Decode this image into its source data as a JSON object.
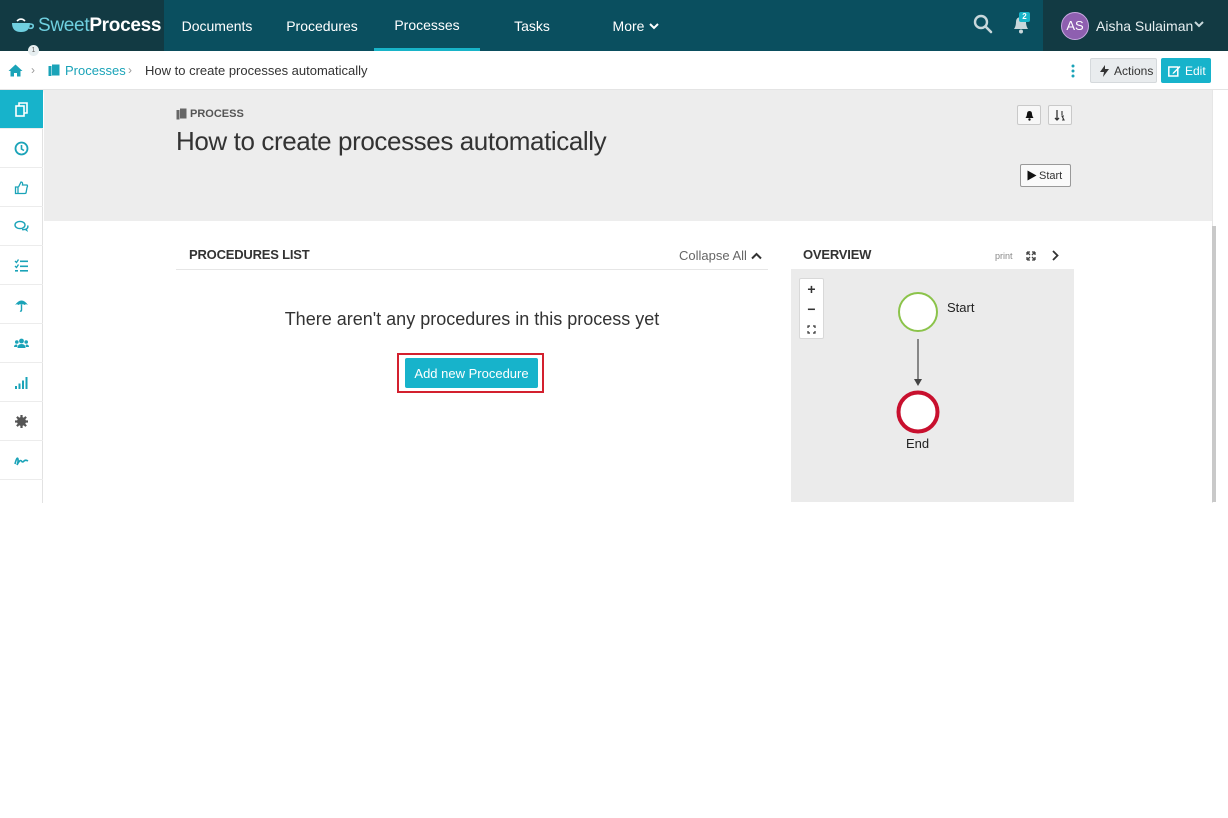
{
  "brand": {
    "light": "Sweet",
    "bold": "Process"
  },
  "nav": {
    "items": [
      {
        "label": "Documents"
      },
      {
        "label": "Procedures"
      },
      {
        "label": "Processes"
      },
      {
        "label": "Tasks"
      },
      {
        "label": "More"
      }
    ],
    "active_item": "Processes",
    "notifications_count": "2"
  },
  "user": {
    "initials": "AS",
    "name": "Aisha Sulaiman"
  },
  "breadcrumb": {
    "section": "Processes",
    "current": "How to create processes automatically"
  },
  "toolbar": {
    "actions_label": "Actions",
    "edit_label": "Edit"
  },
  "sidebar": {
    "items": [
      {
        "icon": "documents-icon"
      },
      {
        "icon": "clock-icon",
        "badge": "1"
      },
      {
        "icon": "thumbs-up-icon"
      },
      {
        "icon": "comments-icon"
      },
      {
        "icon": "checklist-icon"
      },
      {
        "icon": "umbrella-icon"
      },
      {
        "icon": "users-icon"
      },
      {
        "icon": "signal-bars-icon"
      },
      {
        "icon": "gear-icon"
      },
      {
        "icon": "signature-icon"
      }
    ]
  },
  "header": {
    "type_label": "PROCESS",
    "title": "How to create processes automatically",
    "start_label": "Start"
  },
  "procedures": {
    "title": "PROCEDURES LIST",
    "collapse_label": "Collapse All",
    "empty_message": "There aren't any procedures in this process yet",
    "add_label": "Add new Procedure"
  },
  "overview": {
    "title": "OVERVIEW",
    "print_label": "print",
    "zoom_in": "+",
    "zoom_out": "−",
    "start_node": "Start",
    "end_node": "End"
  },
  "colors": {
    "topbar": "#0a4f5f",
    "brand_dark": "#123a43",
    "accent": "#17b3cb",
    "highlight": "#d3202e",
    "start_node": "#8bc34a",
    "end_node": "#c8102e"
  }
}
